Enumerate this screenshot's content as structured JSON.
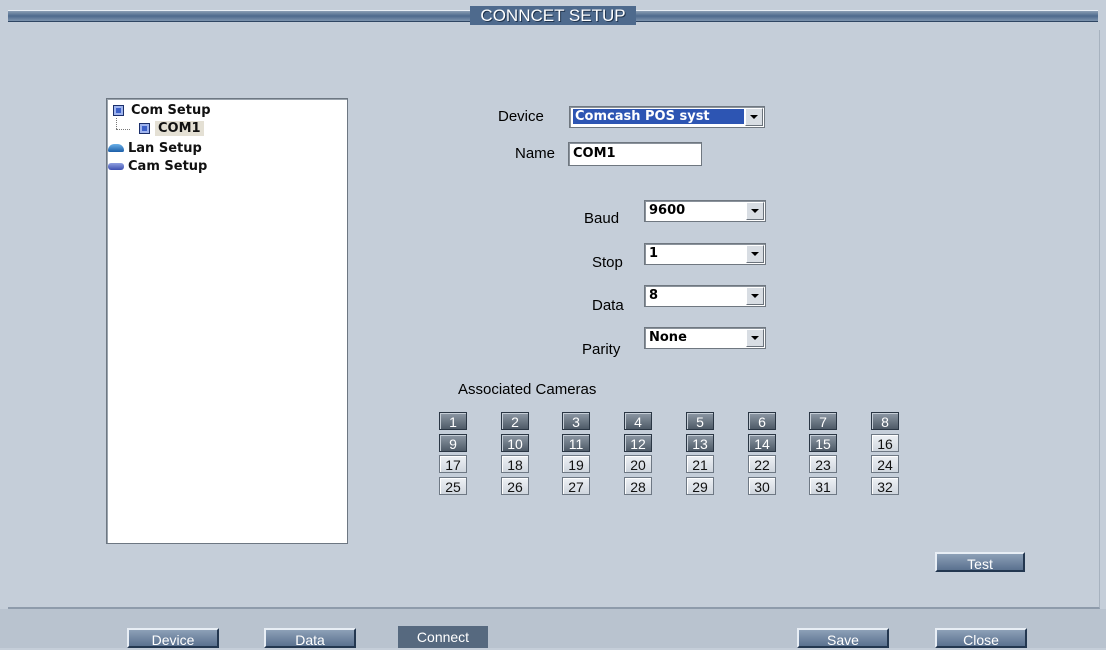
{
  "window": {
    "title": "CONNCET SETUP"
  },
  "tree": {
    "items": [
      {
        "label": "Com Setup",
        "icon": "com-port-icon"
      },
      {
        "label": "COM1",
        "icon": "com-port-icon",
        "selected": true
      },
      {
        "label": "Lan Setup",
        "icon": "network-icon"
      },
      {
        "label": "Cam Setup",
        "icon": "camera-icon"
      }
    ]
  },
  "form": {
    "device_label": "Device",
    "device_value": "Comcash POS syst",
    "name_label": "Name",
    "name_value": "COM1",
    "baud_label": "Baud",
    "baud_value": "9600",
    "stop_label": "Stop",
    "stop_value": "1",
    "data_label": "Data",
    "data_value": "8",
    "parity_label": "Parity",
    "parity_value": "None"
  },
  "cameras": {
    "title": "Associated Cameras",
    "items": [
      {
        "n": "1",
        "on": true
      },
      {
        "n": "2",
        "on": true
      },
      {
        "n": "3",
        "on": true
      },
      {
        "n": "4",
        "on": true
      },
      {
        "n": "5",
        "on": true
      },
      {
        "n": "6",
        "on": true
      },
      {
        "n": "7",
        "on": true
      },
      {
        "n": "8",
        "on": true
      },
      {
        "n": "9",
        "on": true
      },
      {
        "n": "10",
        "on": true
      },
      {
        "n": "11",
        "on": true
      },
      {
        "n": "12",
        "on": true
      },
      {
        "n": "13",
        "on": true
      },
      {
        "n": "14",
        "on": true
      },
      {
        "n": "15",
        "on": true
      },
      {
        "n": "16",
        "on": false
      },
      {
        "n": "17",
        "on": false
      },
      {
        "n": "18",
        "on": false
      },
      {
        "n": "19",
        "on": false
      },
      {
        "n": "20",
        "on": false
      },
      {
        "n": "21",
        "on": false
      },
      {
        "n": "22",
        "on": false
      },
      {
        "n": "23",
        "on": false
      },
      {
        "n": "24",
        "on": false
      },
      {
        "n": "25",
        "on": false
      },
      {
        "n": "26",
        "on": false
      },
      {
        "n": "27",
        "on": false
      },
      {
        "n": "28",
        "on": false
      },
      {
        "n": "29",
        "on": false
      },
      {
        "n": "30",
        "on": false
      },
      {
        "n": "31",
        "on": false
      },
      {
        "n": "32",
        "on": false
      }
    ]
  },
  "buttons": {
    "test": "Test",
    "device": "Device",
    "data": "Data",
    "connect": "Connect",
    "save": "Save",
    "close": "Close"
  }
}
